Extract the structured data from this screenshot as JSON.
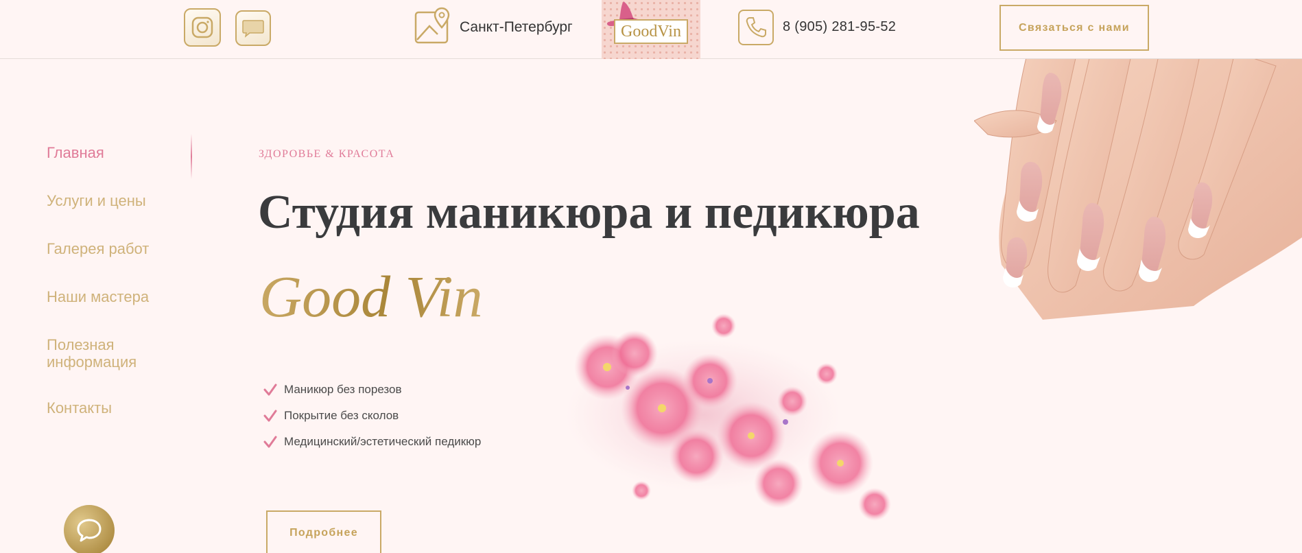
{
  "header": {
    "city": "Санкт-Петербург",
    "logo_text": "GoodVin",
    "phone": "8 (905) 281-95-52",
    "contact_button": "Связаться с нами"
  },
  "nav": {
    "items": [
      {
        "label": "Главная",
        "active": true
      },
      {
        "label": "Услуги и цены"
      },
      {
        "label": "Галерея работ"
      },
      {
        "label": "Наши мастера"
      },
      {
        "label": "Полезная информация"
      },
      {
        "label": "Контакты"
      }
    ]
  },
  "hero": {
    "eyebrow": "ЗДОРОВЬЕ & КРАСОТА",
    "title": "Студия маникюра и педикюра",
    "brand": "Good Vin",
    "features": [
      "Маникюр без порезов",
      "Покрытие без сколов",
      "Медицинский/эстетический педикюр"
    ],
    "more_button": "Подробнее"
  },
  "colors": {
    "background": "#fff5f4",
    "gold": "#c9a966",
    "pink_accent": "#e07b98",
    "title_text": "#3a3b3d"
  },
  "icons": [
    "instagram-icon",
    "message-icon",
    "map-location-icon",
    "phone-icon",
    "check-icon",
    "chat-icon"
  ]
}
